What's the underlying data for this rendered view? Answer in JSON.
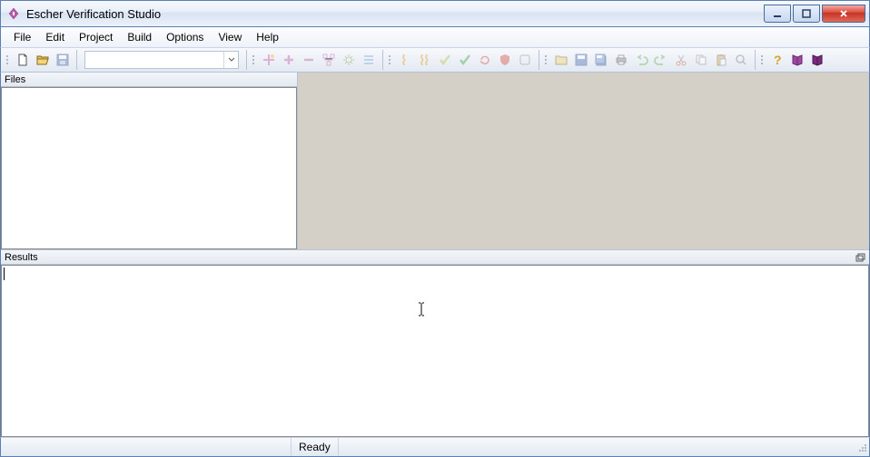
{
  "window": {
    "title": "Escher Verification Studio"
  },
  "menubar": {
    "items": [
      "File",
      "Edit",
      "Project",
      "Build",
      "Options",
      "View",
      "Help"
    ]
  },
  "panels": {
    "files": {
      "title": "Files"
    },
    "results": {
      "title": "Results"
    }
  },
  "statusbar": {
    "message": "Ready"
  }
}
